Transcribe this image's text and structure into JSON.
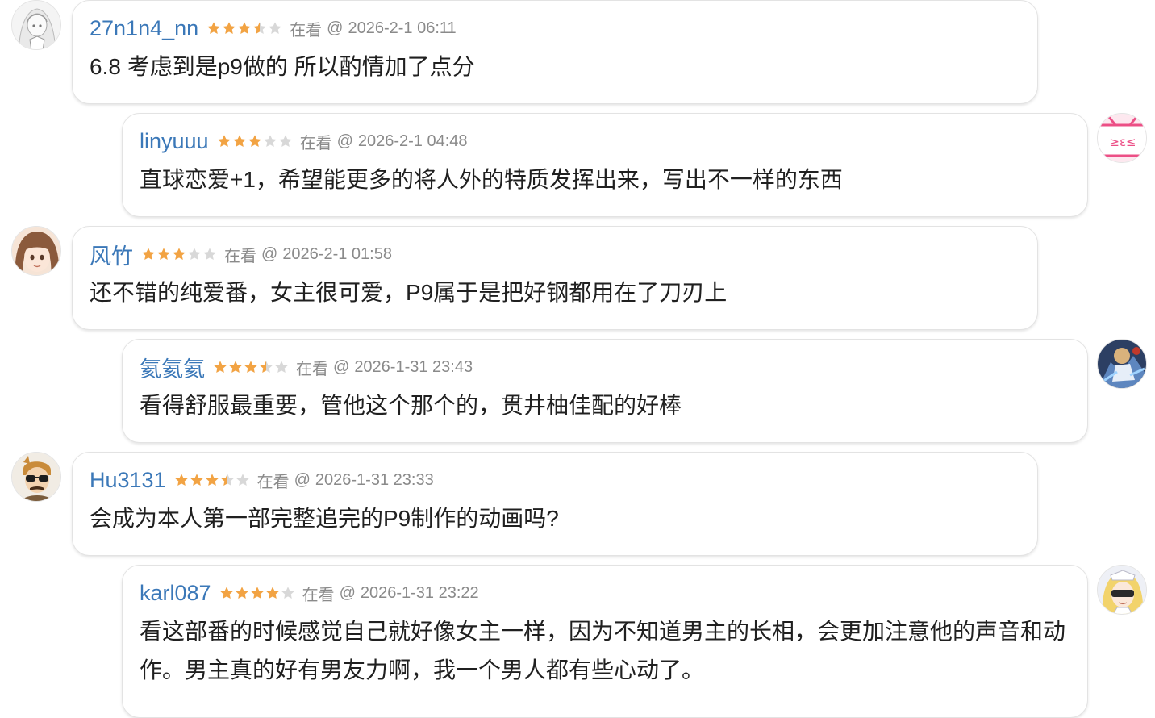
{
  "colors": {
    "username": "#3b78b8",
    "star_filled": "#f2a343",
    "star_empty": "#d8d8d8",
    "meta_text": "#8a8a8a",
    "border": "#e3e3e3"
  },
  "comments": [
    {
      "username": "27n1n4_nn",
      "rating": 3.5,
      "status": "在看",
      "at": "@",
      "time": "2026-2-1 06:11",
      "text": "6.8 考虑到是p9做的 所以酌情加了点分",
      "avatar_icon": "anime-girl-sketch-avatar"
    },
    {
      "username": "linyuuu",
      "rating": 3,
      "status": "在看",
      "at": "@",
      "time": "2026-2-1 04:48",
      "text": "直球恋爱+1，希望能更多的将人外的特质发挥出来，写出不一样的东西",
      "avatar_icon": "pink-tv-avatar"
    },
    {
      "username": "风竹",
      "rating": 3,
      "status": "在看",
      "at": "@",
      "time": "2026-2-1 01:58",
      "text": "还不错的纯爱番，女主很可爱，P9属于是把好钢都用在了刀刃上",
      "avatar_icon": "anime-girl-face-avatar"
    },
    {
      "username": "氦氦氦",
      "rating": 3.5,
      "status": "在看",
      "at": "@",
      "time": "2026-1-31 23:43",
      "text": "看得舒服最重要，管他这个那个的，贯井柚佳配的好棒",
      "avatar_icon": "anime-action-avatar"
    },
    {
      "username": "Hu3131",
      "rating": 3.5,
      "status": "在看",
      "at": "@",
      "time": "2026-1-31 23:33",
      "text": "会成为本人第一部完整追完的P9制作的动画吗?",
      "avatar_icon": "sunglasses-man-avatar"
    },
    {
      "username": "karl087",
      "rating": 4,
      "status": "在看",
      "at": "@",
      "time": "2026-1-31 23:22",
      "text": "看这部番的时候感觉自己就好像女主一样，因为不知道男主的长相，会更加注意他的声音和动作。男主真的好有男友力啊，我一个男人都有些心动了。",
      "avatar_icon": "blonde-maid-avatar"
    }
  ]
}
